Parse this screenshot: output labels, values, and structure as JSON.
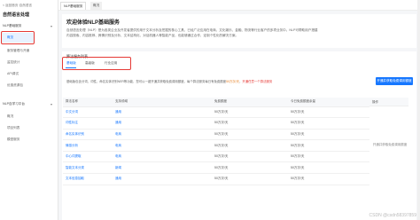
{
  "sidebar": {
    "back": "< 返回首页·自然语言",
    "title": "自然语言处理",
    "groups": [
      {
        "label": "NLP基础服务"
      },
      {
        "label": "NLP自学习平台"
      }
    ],
    "items": [
      {
        "label": "概览"
      },
      {
        "label": "服务管理与开通"
      },
      {
        "label": "监控统计"
      },
      {
        "label": "API调试"
      },
      {
        "label": "优惠资源包"
      },
      {
        "label": "概况"
      },
      {
        "label": "项目列表"
      },
      {
        "label": "模型服务"
      }
    ]
  },
  "topbar": {
    "tabs": [
      {
        "label": "NLP基础服务"
      },
      {
        "label": "概况"
      }
    ]
  },
  "intro": {
    "title": "欢迎体验NLP基础服务",
    "line1": "自然语言处理（NLP）是为各类企业及开发者提供的用于文本分析及挖掘的核心工具，已经广泛应用在电商、文化娱乐、金融、物流等行业客户的多项业务中。NLP可帮助用户搭建",
    "line2": "内容搜索、内容推荐、舆情识别及分析、文本结构化、对话机器人等智能产品，也能够通过合作，定制个性化的解决方案。"
  },
  "services": {
    "heading": "算法服务列表",
    "tabs": [
      {
        "label": "基础版"
      },
      {
        "label": "高级版"
      },
      {
        "label": "行业应用"
      }
    ],
    "note": "基础版包含分词、词性、命名实体识别NER等功能，您可以一键开通并获取免费调用额度，每个算法服务每日有免费额度",
    "note_red": "50万次/天",
    "note_red2": "开通任意一个算法服务",
    "button": "开通并获取免费调用额度",
    "columns": [
      "算法名称",
      "支持领域",
      "免费额度",
      "今日免费额度余量",
      "操作"
    ],
    "rows": [
      {
        "name": "中文分词",
        "domain": "通用",
        "free": "50万次/天",
        "remaining": "50万次/天"
      },
      {
        "name": "词性标注",
        "domain": "通用",
        "free": "50万次/天",
        "remaining": "50万次/天"
      },
      {
        "name": "命名实体识别",
        "domain": "电商",
        "free": "50万次/天",
        "remaining": "50万次/天"
      },
      {
        "name": "情感分析",
        "domain": "电商",
        "free": "50万次/天",
        "remaining": "50万次/天"
      },
      {
        "name": "中心词提取",
        "domain": "电商",
        "free": "50万次/天",
        "remaining": "50万次/天"
      },
      {
        "name": "智能文本分类",
        "domain": "新闻",
        "free": "50万次/天",
        "remaining": "50万次/天"
      },
      {
        "name": "文本信息抽取",
        "domain": "通用",
        "free": "50万次/天",
        "remaining": "50万次/天"
      }
    ],
    "op_text": "开通并获取免费调用额度"
  },
  "watermark": "CSDN @csdn58397859",
  "colors": {
    "accent": "#1677ff",
    "highlight": "#e53935"
  }
}
